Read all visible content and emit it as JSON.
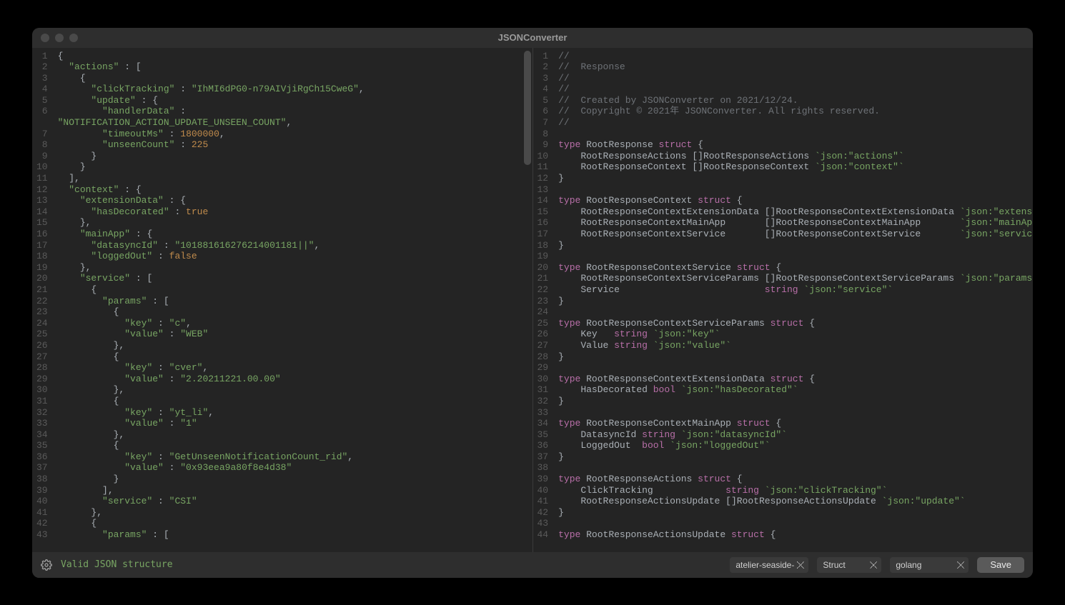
{
  "window": {
    "title": "JSONConverter"
  },
  "footer": {
    "status": "Valid JSON structure",
    "theme_select": "atelier-seaside-",
    "kind_select": "Struct",
    "lang_select": "golang",
    "save_label": "Save"
  },
  "left_editor": {
    "visible_lines": 43,
    "source_json": {
      "actions": [
        {
          "clickTracking": "IhMI6dPG0-n79AIVjiRgCh15CweG",
          "update": {
            "handlerData": "NOTIFICATION_ACTION_UPDATE_UNSEEN_COUNT",
            "timeoutMs": 1800000,
            "unseenCount": 225
          }
        }
      ],
      "context": {
        "extensionData": {
          "hasDecorated": true
        },
        "mainApp": {
          "datasyncId": "101881616276214001181||",
          "loggedOut": false
        },
        "service": [
          {
            "params": [
              {
                "key": "c",
                "value": "WEB"
              },
              {
                "key": "cver",
                "value": "2.20211221.00.00"
              },
              {
                "key": "yt_li",
                "value": "1"
              },
              {
                "key": "GetUnseenNotificationCount_rid",
                "value": "0x93eea9a80f8e4d38"
              }
            ],
            "service": "CSI"
          },
          {
            "params": []
          }
        ]
      }
    },
    "tokens": [
      [
        {
          "t": "{",
          "c": "punc"
        }
      ],
      [
        {
          "t": "  ",
          "c": "punc"
        },
        {
          "t": "\"actions\"",
          "c": "key"
        },
        {
          "t": " : [",
          "c": "punc"
        }
      ],
      [
        {
          "t": "    {",
          "c": "punc"
        }
      ],
      [
        {
          "t": "      ",
          "c": "punc"
        },
        {
          "t": "\"clickTracking\"",
          "c": "key"
        },
        {
          "t": " : ",
          "c": "punc"
        },
        {
          "t": "\"IhMI6dPG0-n79AIVjiRgCh15CweG\"",
          "c": "str"
        },
        {
          "t": ",",
          "c": "punc"
        }
      ],
      [
        {
          "t": "      ",
          "c": "punc"
        },
        {
          "t": "\"update\"",
          "c": "key"
        },
        {
          "t": " : {",
          "c": "punc"
        }
      ],
      [
        {
          "t": "        ",
          "c": "punc"
        },
        {
          "t": "\"handlerData\"",
          "c": "key"
        },
        {
          "t": " : ",
          "c": "punc"
        }
      ],
      [
        {
          "t": "\"NOTIFICATION_ACTION_UPDATE_UNSEEN_COUNT\"",
          "c": "str"
        },
        {
          "t": ",",
          "c": "punc"
        }
      ],
      [
        {
          "t": "        ",
          "c": "punc"
        },
        {
          "t": "\"timeoutMs\"",
          "c": "key"
        },
        {
          "t": " : ",
          "c": "punc"
        },
        {
          "t": "1800000",
          "c": "num"
        },
        {
          "t": ",",
          "c": "punc"
        }
      ],
      [
        {
          "t": "        ",
          "c": "punc"
        },
        {
          "t": "\"unseenCount\"",
          "c": "key"
        },
        {
          "t": " : ",
          "c": "punc"
        },
        {
          "t": "225",
          "c": "num"
        }
      ],
      [
        {
          "t": "      }",
          "c": "punc"
        }
      ],
      [
        {
          "t": "    }",
          "c": "punc"
        }
      ],
      [
        {
          "t": "  ],",
          "c": "punc"
        }
      ],
      [
        {
          "t": "  ",
          "c": "punc"
        },
        {
          "t": "\"context\"",
          "c": "key"
        },
        {
          "t": " : {",
          "c": "punc"
        }
      ],
      [
        {
          "t": "    ",
          "c": "punc"
        },
        {
          "t": "\"extensionData\"",
          "c": "key"
        },
        {
          "t": " : {",
          "c": "punc"
        }
      ],
      [
        {
          "t": "      ",
          "c": "punc"
        },
        {
          "t": "\"hasDecorated\"",
          "c": "key"
        },
        {
          "t": " : ",
          "c": "punc"
        },
        {
          "t": "true",
          "c": "bool"
        }
      ],
      [
        {
          "t": "    },",
          "c": "punc"
        }
      ],
      [
        {
          "t": "    ",
          "c": "punc"
        },
        {
          "t": "\"mainApp\"",
          "c": "key"
        },
        {
          "t": " : {",
          "c": "punc"
        }
      ],
      [
        {
          "t": "      ",
          "c": "punc"
        },
        {
          "t": "\"datasyncId\"",
          "c": "key"
        },
        {
          "t": " : ",
          "c": "punc"
        },
        {
          "t": "\"101881616276214001181||\"",
          "c": "str"
        },
        {
          "t": ",",
          "c": "punc"
        }
      ],
      [
        {
          "t": "      ",
          "c": "punc"
        },
        {
          "t": "\"loggedOut\"",
          "c": "key"
        },
        {
          "t": " : ",
          "c": "punc"
        },
        {
          "t": "false",
          "c": "bool"
        }
      ],
      [
        {
          "t": "    },",
          "c": "punc"
        }
      ],
      [
        {
          "t": "    ",
          "c": "punc"
        },
        {
          "t": "\"service\"",
          "c": "key"
        },
        {
          "t": " : [",
          "c": "punc"
        }
      ],
      [
        {
          "t": "      {",
          "c": "punc"
        }
      ],
      [
        {
          "t": "        ",
          "c": "punc"
        },
        {
          "t": "\"params\"",
          "c": "key"
        },
        {
          "t": " : [",
          "c": "punc"
        }
      ],
      [
        {
          "t": "          {",
          "c": "punc"
        }
      ],
      [
        {
          "t": "            ",
          "c": "punc"
        },
        {
          "t": "\"key\"",
          "c": "key"
        },
        {
          "t": " : ",
          "c": "punc"
        },
        {
          "t": "\"c\"",
          "c": "str"
        },
        {
          "t": ",",
          "c": "punc"
        }
      ],
      [
        {
          "t": "            ",
          "c": "punc"
        },
        {
          "t": "\"value\"",
          "c": "key"
        },
        {
          "t": " : ",
          "c": "punc"
        },
        {
          "t": "\"WEB\"",
          "c": "str"
        }
      ],
      [
        {
          "t": "          },",
          "c": "punc"
        }
      ],
      [
        {
          "t": "          {",
          "c": "punc"
        }
      ],
      [
        {
          "t": "            ",
          "c": "punc"
        },
        {
          "t": "\"key\"",
          "c": "key"
        },
        {
          "t": " : ",
          "c": "punc"
        },
        {
          "t": "\"cver\"",
          "c": "str"
        },
        {
          "t": ",",
          "c": "punc"
        }
      ],
      [
        {
          "t": "            ",
          "c": "punc"
        },
        {
          "t": "\"value\"",
          "c": "key"
        },
        {
          "t": " : ",
          "c": "punc"
        },
        {
          "t": "\"2.20211221.00.00\"",
          "c": "str"
        }
      ],
      [
        {
          "t": "          },",
          "c": "punc"
        }
      ],
      [
        {
          "t": "          {",
          "c": "punc"
        }
      ],
      [
        {
          "t": "            ",
          "c": "punc"
        },
        {
          "t": "\"key\"",
          "c": "key"
        },
        {
          "t": " : ",
          "c": "punc"
        },
        {
          "t": "\"yt_li\"",
          "c": "str"
        },
        {
          "t": ",",
          "c": "punc"
        }
      ],
      [
        {
          "t": "            ",
          "c": "punc"
        },
        {
          "t": "\"value\"",
          "c": "key"
        },
        {
          "t": " : ",
          "c": "punc"
        },
        {
          "t": "\"1\"",
          "c": "str"
        }
      ],
      [
        {
          "t": "          },",
          "c": "punc"
        }
      ],
      [
        {
          "t": "          {",
          "c": "punc"
        }
      ],
      [
        {
          "t": "            ",
          "c": "punc"
        },
        {
          "t": "\"key\"",
          "c": "key"
        },
        {
          "t": " : ",
          "c": "punc"
        },
        {
          "t": "\"GetUnseenNotificationCount_rid\"",
          "c": "str"
        },
        {
          "t": ",",
          "c": "punc"
        }
      ],
      [
        {
          "t": "            ",
          "c": "punc"
        },
        {
          "t": "\"value\"",
          "c": "key"
        },
        {
          "t": " : ",
          "c": "punc"
        },
        {
          "t": "\"0x93eea9a80f8e4d38\"",
          "c": "str"
        }
      ],
      [
        {
          "t": "          }",
          "c": "punc"
        }
      ],
      [
        {
          "t": "        ],",
          "c": "punc"
        }
      ],
      [
        {
          "t": "        ",
          "c": "punc"
        },
        {
          "t": "\"service\"",
          "c": "key"
        },
        {
          "t": " : ",
          "c": "punc"
        },
        {
          "t": "\"CSI\"",
          "c": "str"
        }
      ],
      [
        {
          "t": "      },",
          "c": "punc"
        }
      ],
      [
        {
          "t": "      {",
          "c": "punc"
        }
      ],
      [
        {
          "t": "        ",
          "c": "punc"
        },
        {
          "t": "\"params\"",
          "c": "key"
        },
        {
          "t": " : [",
          "c": "punc"
        }
      ]
    ],
    "line_numbers": [
      1,
      2,
      3,
      4,
      5,
      6,
      "",
      7,
      8,
      9,
      10,
      11,
      12,
      13,
      14,
      15,
      16,
      17,
      18,
      19,
      20,
      21,
      22,
      23,
      24,
      25,
      26,
      27,
      28,
      29,
      30,
      31,
      32,
      33,
      34,
      35,
      36,
      37,
      38,
      39,
      40,
      41,
      42,
      43
    ]
  },
  "right_editor": {
    "visible_lines": 44,
    "tokens": [
      [
        {
          "t": "//",
          "c": "cmt"
        }
      ],
      [
        {
          "t": "//  Response",
          "c": "cmt"
        }
      ],
      [
        {
          "t": "//",
          "c": "cmt"
        }
      ],
      [
        {
          "t": "//",
          "c": "cmt"
        }
      ],
      [
        {
          "t": "//  Created by JSONConverter on 2021/12/24.",
          "c": "cmt"
        }
      ],
      [
        {
          "t": "//  Copyright © 2021年 JSONConverter. All rights reserved.",
          "c": "cmt"
        }
      ],
      [
        {
          "t": "//",
          "c": "cmt"
        }
      ],
      [],
      [
        {
          "t": "type",
          "c": "kw"
        },
        {
          "t": " RootResponse ",
          "c": "type"
        },
        {
          "t": "struct",
          "c": "kw"
        },
        {
          "t": " {",
          "c": "punc"
        }
      ],
      [
        {
          "t": "    RootResponseActions []RootResponseActions ",
          "c": "type"
        },
        {
          "t": "`json:\"actions\"`",
          "c": "tag"
        }
      ],
      [
        {
          "t": "    RootResponseContext []RootResponseContext ",
          "c": "type"
        },
        {
          "t": "`json:\"context\"`",
          "c": "tag"
        }
      ],
      [
        {
          "t": "}",
          "c": "punc"
        }
      ],
      [],
      [
        {
          "t": "type",
          "c": "kw"
        },
        {
          "t": " RootResponseContext ",
          "c": "type"
        },
        {
          "t": "struct",
          "c": "kw"
        },
        {
          "t": " {",
          "c": "punc"
        }
      ],
      [
        {
          "t": "    RootResponseContextExtensionData []RootResponseContextExtensionData ",
          "c": "type"
        },
        {
          "t": "`json:\"extensionData\"`",
          "c": "tag"
        }
      ],
      [
        {
          "t": "    RootResponseContextMainApp       []RootResponseContextMainApp       ",
          "c": "type"
        },
        {
          "t": "`json:\"mainApp\"`",
          "c": "tag"
        }
      ],
      [
        {
          "t": "    RootResponseContextService       []RootResponseContextService       ",
          "c": "type"
        },
        {
          "t": "`json:\"service\"`",
          "c": "tag"
        }
      ],
      [
        {
          "t": "}",
          "c": "punc"
        }
      ],
      [],
      [
        {
          "t": "type",
          "c": "kw"
        },
        {
          "t": " RootResponseContextService ",
          "c": "type"
        },
        {
          "t": "struct",
          "c": "kw"
        },
        {
          "t": " {",
          "c": "punc"
        }
      ],
      [
        {
          "t": "    RootResponseContextServiceParams []RootResponseContextServiceParams ",
          "c": "type"
        },
        {
          "t": "`json:\"params\"`",
          "c": "tag"
        }
      ],
      [
        {
          "t": "    Service                          ",
          "c": "type"
        },
        {
          "t": "string",
          "c": "kw"
        },
        {
          "t": " ",
          "c": "type"
        },
        {
          "t": "`json:\"service\"`",
          "c": "tag"
        }
      ],
      [
        {
          "t": "}",
          "c": "punc"
        }
      ],
      [],
      [
        {
          "t": "type",
          "c": "kw"
        },
        {
          "t": " RootResponseContextServiceParams ",
          "c": "type"
        },
        {
          "t": "struct",
          "c": "kw"
        },
        {
          "t": " {",
          "c": "punc"
        }
      ],
      [
        {
          "t": "    Key   ",
          "c": "type"
        },
        {
          "t": "string",
          "c": "kw"
        },
        {
          "t": " ",
          "c": "type"
        },
        {
          "t": "`json:\"key\"`",
          "c": "tag"
        }
      ],
      [
        {
          "t": "    Value ",
          "c": "type"
        },
        {
          "t": "string",
          "c": "kw"
        },
        {
          "t": " ",
          "c": "type"
        },
        {
          "t": "`json:\"value\"`",
          "c": "tag"
        }
      ],
      [
        {
          "t": "}",
          "c": "punc"
        }
      ],
      [],
      [
        {
          "t": "type",
          "c": "kw"
        },
        {
          "t": " RootResponseContextExtensionData ",
          "c": "type"
        },
        {
          "t": "struct",
          "c": "kw"
        },
        {
          "t": " {",
          "c": "punc"
        }
      ],
      [
        {
          "t": "    HasDecorated ",
          "c": "type"
        },
        {
          "t": "bool",
          "c": "kw"
        },
        {
          "t": " ",
          "c": "type"
        },
        {
          "t": "`json:\"hasDecorated\"`",
          "c": "tag"
        }
      ],
      [
        {
          "t": "}",
          "c": "punc"
        }
      ],
      [],
      [
        {
          "t": "type",
          "c": "kw"
        },
        {
          "t": " RootResponseContextMainApp ",
          "c": "type"
        },
        {
          "t": "struct",
          "c": "kw"
        },
        {
          "t": " {",
          "c": "punc"
        }
      ],
      [
        {
          "t": "    DatasyncId ",
          "c": "type"
        },
        {
          "t": "string",
          "c": "kw"
        },
        {
          "t": " ",
          "c": "type"
        },
        {
          "t": "`json:\"datasyncId\"`",
          "c": "tag"
        }
      ],
      [
        {
          "t": "    LoggedOut  ",
          "c": "type"
        },
        {
          "t": "bool",
          "c": "kw"
        },
        {
          "t": " ",
          "c": "type"
        },
        {
          "t": "`json:\"loggedOut\"`",
          "c": "tag"
        }
      ],
      [
        {
          "t": "}",
          "c": "punc"
        }
      ],
      [],
      [
        {
          "t": "type",
          "c": "kw"
        },
        {
          "t": " RootResponseActions ",
          "c": "type"
        },
        {
          "t": "struct",
          "c": "kw"
        },
        {
          "t": " {",
          "c": "punc"
        }
      ],
      [
        {
          "t": "    ClickTracking             ",
          "c": "type"
        },
        {
          "t": "string",
          "c": "kw"
        },
        {
          "t": " ",
          "c": "type"
        },
        {
          "t": "`json:\"clickTracking\"`",
          "c": "tag"
        }
      ],
      [
        {
          "t": "    RootResponseActionsUpdate []RootResponseActionsUpdate ",
          "c": "type"
        },
        {
          "t": "`json:\"update\"`",
          "c": "tag"
        }
      ],
      [
        {
          "t": "}",
          "c": "punc"
        }
      ],
      [],
      [
        {
          "t": "type",
          "c": "kw"
        },
        {
          "t": " RootResponseActionsUpdate ",
          "c": "type"
        },
        {
          "t": "struct",
          "c": "kw"
        },
        {
          "t": " {",
          "c": "punc"
        }
      ]
    ],
    "line_numbers": [
      1,
      2,
      3,
      4,
      5,
      6,
      7,
      8,
      9,
      10,
      11,
      12,
      13,
      14,
      15,
      16,
      17,
      18,
      19,
      20,
      21,
      22,
      23,
      24,
      25,
      26,
      27,
      28,
      29,
      30,
      31,
      32,
      33,
      34,
      35,
      36,
      37,
      38,
      39,
      40,
      41,
      42,
      43,
      44
    ]
  }
}
